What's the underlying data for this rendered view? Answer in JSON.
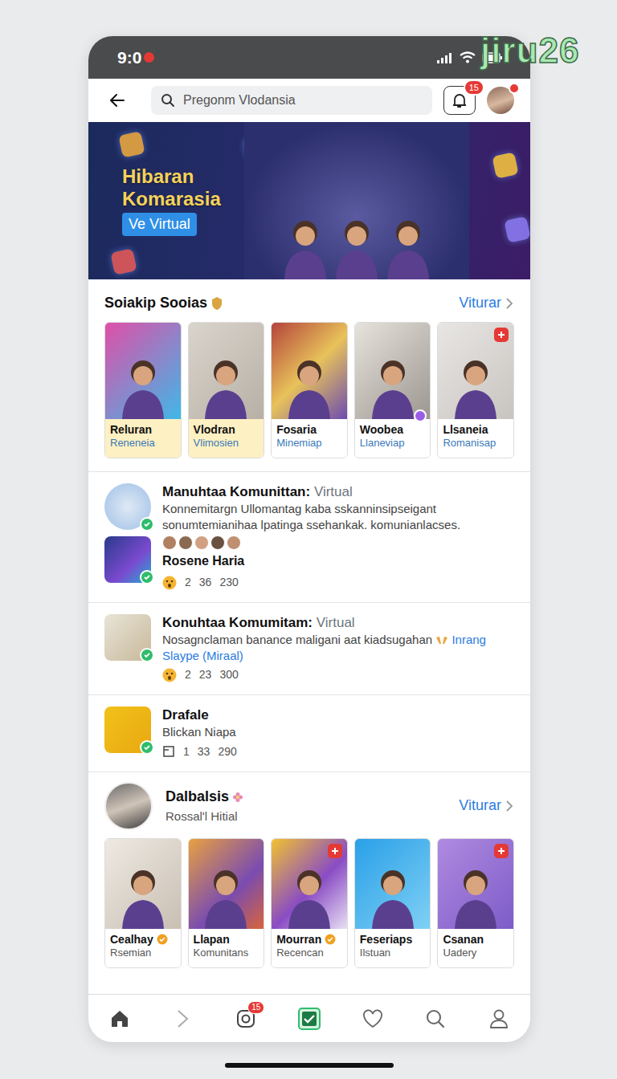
{
  "watermark": "jiru26",
  "status_bar": {
    "time": "9:0",
    "recording": true
  },
  "header": {
    "search": {
      "placeholder": "Pregonm Vlodansia"
    },
    "badge": "15",
    "avatar_alert": true
  },
  "banner": {
    "title": "Hibaran Komarasia",
    "tag": "Ve Virtual"
  },
  "featured": {
    "title": "Soiakip Sooias",
    "link": "Viturar",
    "cards": [
      {
        "name": "Reluran",
        "subtitle": "Reneneia",
        "color": "#fdf0c2",
        "badge": "none",
        "verified": false
      },
      {
        "name": "Vlodran",
        "subtitle": "Vlimosien",
        "color": "#fdf0c2",
        "badge": "none",
        "verified": false
      },
      {
        "name": "Fosaria",
        "subtitle": "Minemiap",
        "color": "#ffffff",
        "badge": "none",
        "verified": false
      },
      {
        "name": "Woobea",
        "subtitle": "Llaneviap",
        "color": "#ffffff",
        "badge": "dot",
        "verified": false
      },
      {
        "name": "Llsaneia",
        "subtitle": "Romanisap",
        "color": "#ffffff",
        "badge": "plus",
        "verified": false
      }
    ]
  },
  "posts": [
    {
      "kind": "thread",
      "title": "Manuhtaa Komunittan:",
      "tag": "Virtual",
      "body": "Konnemitargn Ullomantag kaba sskanninsipseigant sonumtemianihaa lpatinga ssehankak. komunianlacses.",
      "author": "Rosene Haria",
      "counts": [
        "2",
        "36",
        "230"
      ],
      "verified": true
    },
    {
      "kind": "post",
      "title": "Konuhtaa Komumitam:",
      "tag": "Virtual",
      "body": "Nosagnclaman banance maligani aat kiadsugahan",
      "link": "Inrang Slaype (Miraal)",
      "counts": [
        "2",
        "23",
        "300"
      ],
      "verified": true
    },
    {
      "kind": "simple",
      "title": "Drafale",
      "body": "Blickan Niapa",
      "counts": [
        "1",
        "33",
        "290"
      ],
      "verified": true
    }
  ],
  "group": {
    "title": "Dalbalsis",
    "subtitle": "Rossal'l Hitial",
    "link": "Viturar",
    "cards": [
      {
        "name": "Cealhay",
        "subtitle": "Rsemian",
        "color": "#ffffff",
        "badge": "none",
        "verified": true
      },
      {
        "name": "Llapan",
        "subtitle": "Komunitans",
        "color": "#ffffff",
        "badge": "none",
        "verified": false
      },
      {
        "name": "Mourran",
        "subtitle": "Recencan",
        "color": "#ffffff",
        "badge": "plus",
        "verified": true
      },
      {
        "name": "Feseriaps",
        "subtitle": "Ilstuan",
        "color": "#ffffff",
        "badge": "none",
        "verified": false
      },
      {
        "name": "Csanan",
        "subtitle": "Uadery",
        "color": "#ffffff",
        "badge": "plus",
        "verified": false
      }
    ]
  },
  "bottom_nav": [
    {
      "kind": "home",
      "selected": false
    },
    {
      "kind": "forward",
      "selected": false
    },
    {
      "kind": "camera",
      "selected": false,
      "badge": "15"
    },
    {
      "kind": "tasks",
      "selected": true
    },
    {
      "kind": "likes",
      "selected": false
    },
    {
      "kind": "search",
      "selected": false
    },
    {
      "kind": "profile",
      "selected": false
    }
  ]
}
